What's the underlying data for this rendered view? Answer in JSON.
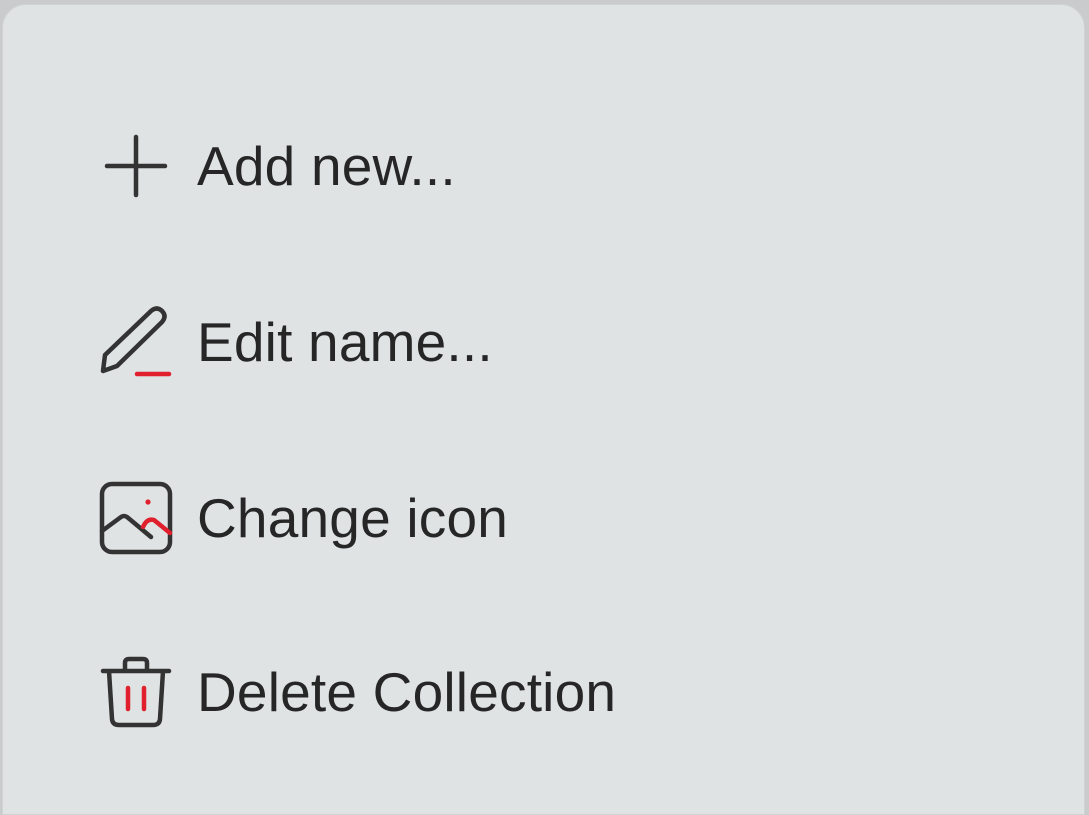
{
  "menu": {
    "items": [
      {
        "label": "Add new...",
        "icon": "plus-icon"
      },
      {
        "label": "Edit name...",
        "icon": "pencil-icon"
      },
      {
        "label": "Change icon",
        "icon": "image-icon"
      },
      {
        "label": "Delete Collection",
        "icon": "trash-icon"
      }
    ]
  },
  "colors": {
    "background": "#dfe3e3",
    "text": "#262626",
    "icon_stroke": "#333333",
    "accent": "#e0202c"
  }
}
